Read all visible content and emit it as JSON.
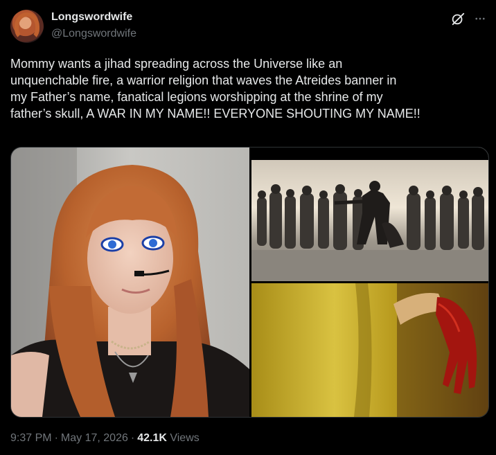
{
  "post": {
    "author": {
      "display_name": "Longswordwife",
      "handle": "@Longswordwife"
    },
    "text": "Mommy wants a jihad spreading across the Universe like an\nunquenchable fire, a warrior religion that waves the Atreides banner in\nmy Father’s name, fanatical legions worshipping at the shrine of my\nfather’s skull, A WAR IN MY NAME!! EVERYONE SHOUTING MY NAME!!",
    "media": [
      {
        "icon": "photo"
      },
      {
        "icon": "photo"
      },
      {
        "icon": "photo"
      }
    ],
    "meta": {
      "time": "9:37 PM",
      "separator": "·",
      "date": "May 17, 2026",
      "views_count": "42.1K",
      "views_label": "Views"
    },
    "icons": {
      "grok": "grok-icon",
      "more": "more-icon"
    },
    "colors": {
      "background": "#000000",
      "text_primary": "#e7e9ea",
      "text_secondary": "#71767b",
      "border": "#2f3336"
    }
  }
}
